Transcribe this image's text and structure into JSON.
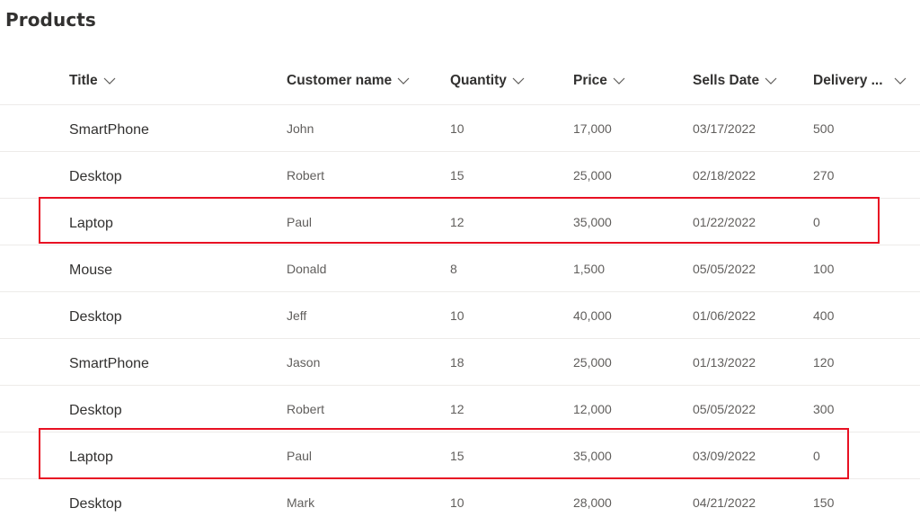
{
  "page": {
    "title": "Products"
  },
  "columns": [
    {
      "label": "Title"
    },
    {
      "label": "Customer name"
    },
    {
      "label": "Quantity"
    },
    {
      "label": "Price"
    },
    {
      "label": "Sells Date"
    },
    {
      "label": "Delivery ..."
    }
  ],
  "rows": [
    {
      "title": "SmartPhone",
      "customer": "John",
      "quantity": "10",
      "price": "17,000",
      "date": "03/17/2022",
      "delivery": "500",
      "highlighted": false
    },
    {
      "title": "Desktop",
      "customer": "Robert",
      "quantity": "15",
      "price": "25,000",
      "date": "02/18/2022",
      "delivery": "270",
      "highlighted": false
    },
    {
      "title": "Laptop",
      "customer": "Paul",
      "quantity": "12",
      "price": "35,000",
      "date": "01/22/2022",
      "delivery": "0",
      "highlighted": true
    },
    {
      "title": "Mouse",
      "customer": "Donald",
      "quantity": "8",
      "price": "1,500",
      "date": "05/05/2022",
      "delivery": "100",
      "highlighted": false
    },
    {
      "title": "Desktop",
      "customer": "Jeff",
      "quantity": "10",
      "price": "40,000",
      "date": "01/06/2022",
      "delivery": "400",
      "highlighted": false
    },
    {
      "title": "SmartPhone",
      "customer": "Jason",
      "quantity": "18",
      "price": "25,000",
      "date": "01/13/2022",
      "delivery": "120",
      "highlighted": false
    },
    {
      "title": "Desktop",
      "customer": "Robert",
      "quantity": "12",
      "price": "12,000",
      "date": "05/05/2022",
      "delivery": "300",
      "highlighted": false
    },
    {
      "title": "Laptop",
      "customer": "Paul",
      "quantity": "15",
      "price": "35,000",
      "date": "03/09/2022",
      "delivery": "0",
      "highlighted": true
    },
    {
      "title": "Desktop",
      "customer": "Mark",
      "quantity": "10",
      "price": "28,000",
      "date": "04/21/2022",
      "delivery": "150",
      "highlighted": false
    }
  ],
  "colors": {
    "highlight": "#e81123",
    "text_primary": "#323130",
    "text_secondary": "#605e5c",
    "divider": "#edebe9"
  },
  "icons": {
    "sort_chevron": "chevron-down-icon"
  }
}
